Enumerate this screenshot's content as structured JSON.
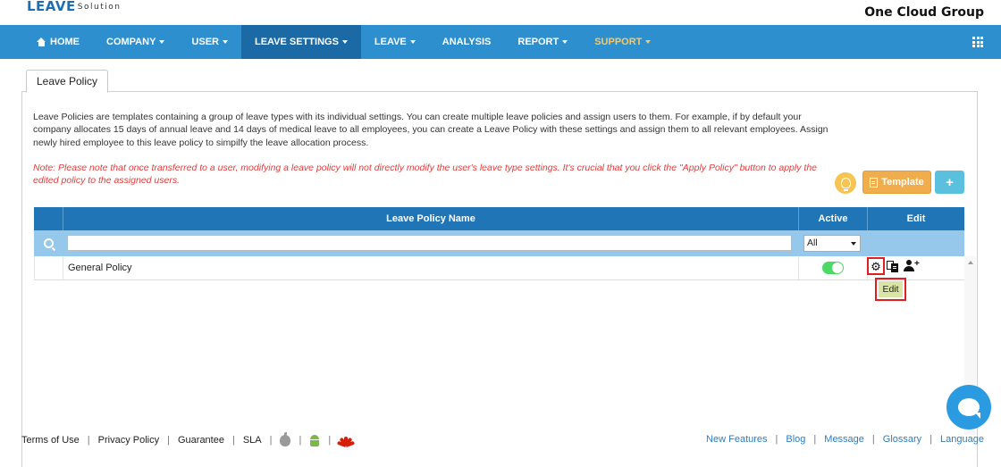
{
  "header": {
    "logo_main": "LEAVE",
    "logo_sub": "Solution",
    "company_name": "One Cloud Group"
  },
  "nav": {
    "items": [
      {
        "label": "HOME",
        "icon": "home-icon"
      },
      {
        "label": "COMPANY",
        "dropdown": true
      },
      {
        "label": "USER",
        "dropdown": true
      },
      {
        "label": "LEAVE SETTINGS",
        "dropdown": true,
        "active": true
      },
      {
        "label": "LEAVE",
        "dropdown": true
      },
      {
        "label": "ANALYSIS"
      },
      {
        "label": "REPORT",
        "dropdown": true
      },
      {
        "label": "SUPPORT",
        "dropdown": true,
        "color": "#f5c96a"
      }
    ],
    "apps_icon": "grid-icon",
    "bg_color": "#2e8fcf",
    "active_color": "#1b6aa6"
  },
  "tab": {
    "label": "Leave Policy"
  },
  "description": "Leave Policies are templates containing a group of leave types with its individual settings. You can create multiple leave policies and assign users to them. For example, if by default your company allocates 15 days of annual leave and 14 days of medical leave to all employees, you can create a Leave Policy with these settings and assign them to all relevant employees. Assign newly hired employee to this leave policy to simpilfy the leave allocation process.",
  "note": "Note: Please note that once transferred to a user, modifying a leave policy will not directly modify the user's leave type settings. It's crucial that you click the \"Apply Policy\" button to apply the edited policy to the assigned users.",
  "toolbar": {
    "tip_icon": "lightbulb-icon",
    "template_label": "Template",
    "add_label": "+"
  },
  "table": {
    "columns": {
      "name": "Leave Policy Name",
      "active": "Active",
      "edit": "Edit"
    },
    "filter": {
      "name_value": "",
      "active_value": "All"
    },
    "rows": [
      {
        "name": "General Policy",
        "active": true
      }
    ],
    "tooltip": "Edit",
    "header_color": "#1f75b6",
    "filter_color": "#95c8ea"
  },
  "footer": {
    "left_links": [
      "Terms of Use",
      "Privacy Policy",
      "Guarantee",
      "SLA"
    ],
    "app_icons": [
      "apple-icon",
      "android-icon",
      "huawei-icon"
    ],
    "right_links": [
      "New Features",
      "Blog",
      "Message",
      "Glossary",
      "Language"
    ]
  },
  "chat": {
    "icon": "chat-icon"
  }
}
